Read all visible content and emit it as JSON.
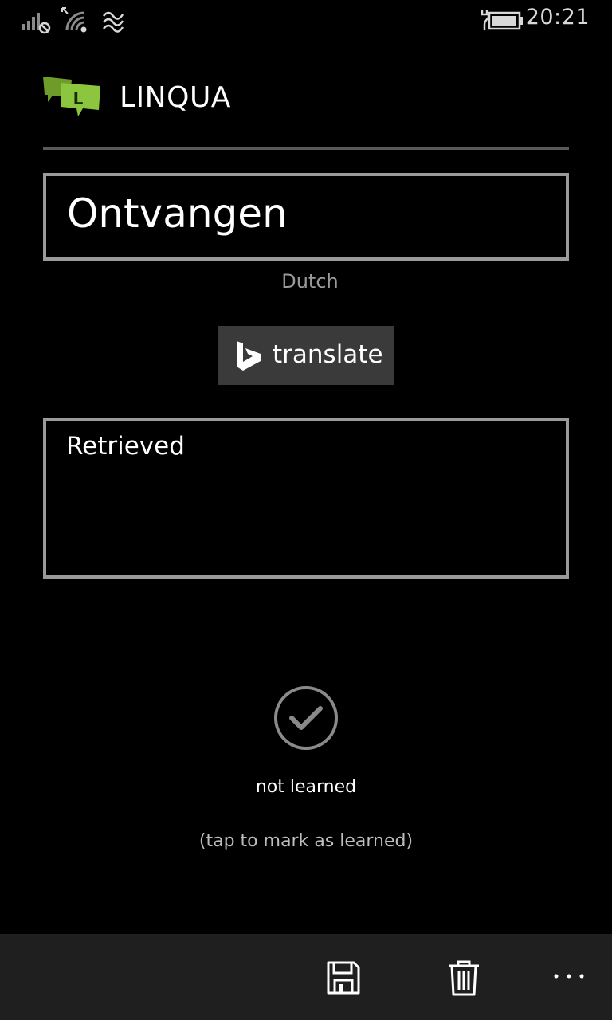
{
  "status_bar": {
    "time": "20:21",
    "icons": [
      "signal-icon",
      "wifi-icon",
      "mobile-data-icon",
      "battery-charging-icon"
    ]
  },
  "header": {
    "title": "LINQUA",
    "logo_icon": "linqua-logo-icon"
  },
  "word": {
    "value": "Ontvangen",
    "language": "Dutch"
  },
  "translate_button": {
    "label": "translate",
    "icon": "bing-icon"
  },
  "translation": {
    "value": "Retrieved"
  },
  "learned": {
    "icon": "checkmark-circle-icon",
    "status": "not learned",
    "hint": "(tap to mark as learned)"
  },
  "app_bar": {
    "buttons": [
      "save-icon",
      "delete-icon",
      "more-icon"
    ]
  },
  "colors": {
    "background": "#000000",
    "app_bar": "#1f1f1f",
    "border": "#9a9a9a",
    "button": "#3a3a3a",
    "logo_green": "#8cc63f"
  }
}
